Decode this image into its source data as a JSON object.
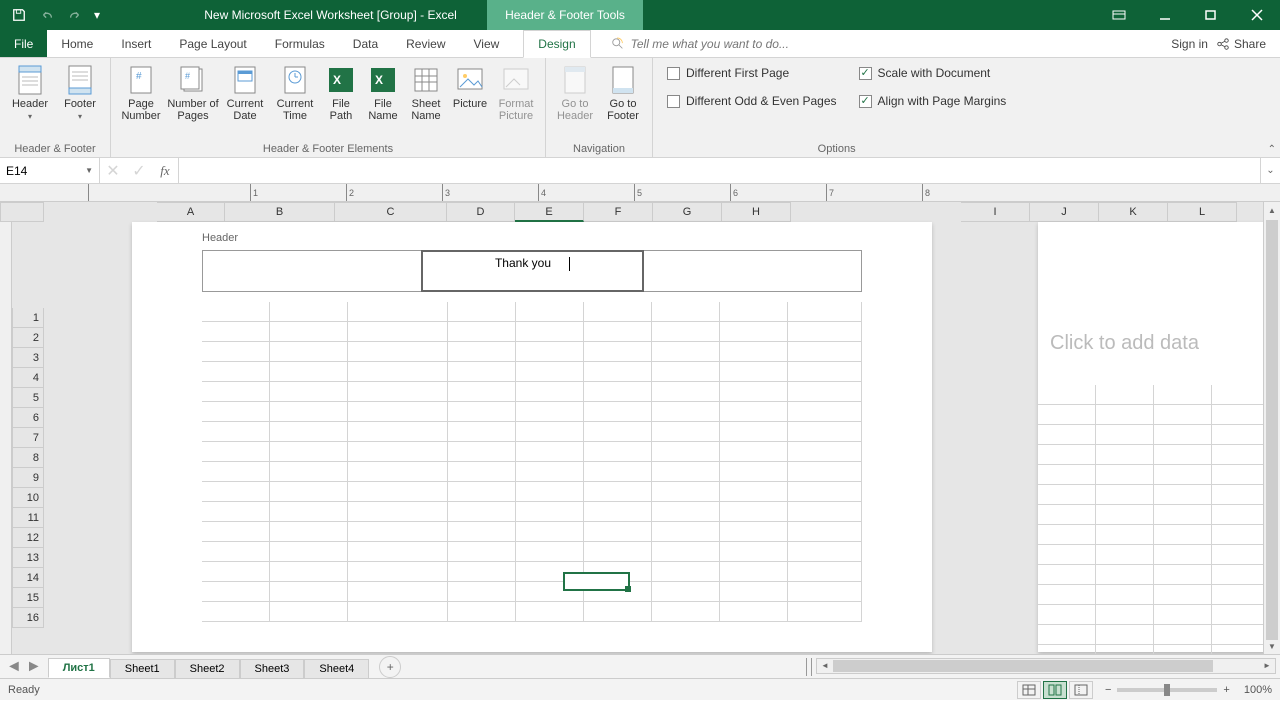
{
  "title": "New Microsoft Excel Worksheet  [Group] - Excel",
  "context_title": "Header & Footer Tools",
  "tabs": [
    "File",
    "Home",
    "Insert",
    "Page Layout",
    "Formulas",
    "Data",
    "Review",
    "View",
    "Design"
  ],
  "active_tab": "Design",
  "tell_me": "Tell me what you want to do...",
  "sign_in": "Sign in",
  "share": "Share",
  "ribbon": {
    "groups": {
      "hf": {
        "label": "Header & Footer",
        "header": "Header",
        "footer": "Footer"
      },
      "elements": {
        "label": "Header & Footer Elements",
        "page_number": "Page Number",
        "num_pages": "Number of Pages",
        "cur_date": "Current Date",
        "cur_time": "Current Time",
        "file_path": "File Path",
        "file_name": "File Name",
        "sheet_name": "Sheet Name",
        "picture": "Picture",
        "format_picture": "Format Picture"
      },
      "nav": {
        "label": "Navigation",
        "goto_header": "Go to Header",
        "goto_footer": "Go to Footer"
      },
      "options": {
        "label": "Options",
        "diff_first": "Different First Page",
        "diff_oe": "Different Odd & Even Pages",
        "scale": "Scale with Document",
        "align": "Align with Page Margins"
      }
    }
  },
  "name_box": "E14",
  "header_label": "Header",
  "header_center_text": "Thank you",
  "add_data_text": "Click to add data",
  "columns": [
    "A",
    "B",
    "C",
    "D",
    "E",
    "F",
    "G",
    "H"
  ],
  "columns2": [
    "I",
    "J",
    "K",
    "L"
  ],
  "rows": [
    1,
    2,
    3,
    4,
    5,
    6,
    7,
    8,
    9,
    10,
    11,
    12,
    13,
    14,
    15,
    16
  ],
  "ruler_ticks": [
    1,
    2,
    3,
    4,
    5,
    6,
    7,
    8
  ],
  "active_cell_ref": "E14",
  "sheets": [
    "Лист1",
    "Sheet1",
    "Sheet2",
    "Sheet3",
    "Sheet4"
  ],
  "active_sheet": "Лист1",
  "status": "Ready",
  "zoom": "100%"
}
